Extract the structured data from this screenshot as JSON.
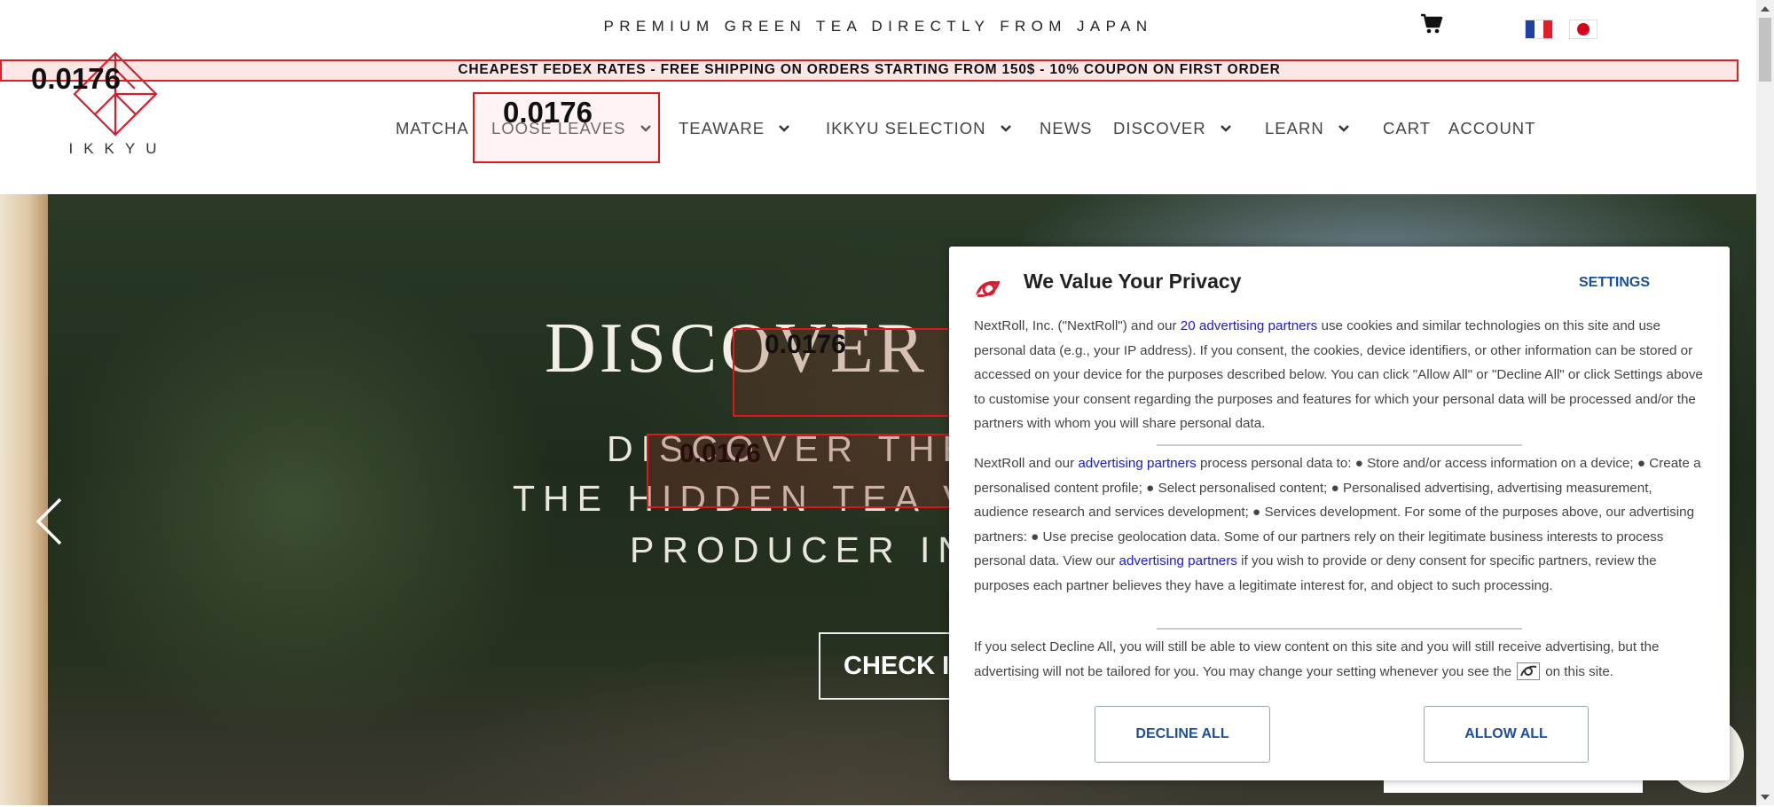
{
  "header": {
    "tagline": "PREMIUM GREEN TEA DIRECTLY FROM JAPAN",
    "icons": {
      "cart": "shopping-cart-icon",
      "french": "flag-france-icon",
      "japanese": "flag-japan-icon"
    }
  },
  "banner": {
    "text": "CHEAPEST FEDEX RATES - FREE SHIPPING ON ORDERS STARTING FROM 150$ - 10% COUPON ON FIRST ORDER"
  },
  "logo": {
    "text": "IKKYU"
  },
  "nav": {
    "items": [
      {
        "label": "MATCHA",
        "dropdown": false
      },
      {
        "label": "LOOSE LEAVES",
        "dropdown": true
      },
      {
        "label": "TEAWARE",
        "dropdown": true
      },
      {
        "label": "IKKYU SELECTION",
        "dropdown": true
      },
      {
        "label": "NEWS",
        "dropdown": false
      },
      {
        "label": "DISCOVER",
        "dropdown": true
      },
      {
        "label": "LEARN",
        "dropdown": true
      },
      {
        "label": "CART",
        "dropdown": false
      },
      {
        "label": "ACCOUNT",
        "dropdown": false
      }
    ]
  },
  "overlay": {
    "labels": [
      "0.0176",
      "0.0176",
      "0.0176",
      "0.0176"
    ],
    "color": "#e01515"
  },
  "hero": {
    "title": "DISCOVER",
    "subtitle_lines": [
      "DISCOVER THE",
      "THE HIDDEN TEA V",
      "PRODUCER IN"
    ],
    "cta": "CHECK IT",
    "prev_icon": "chevron-left-icon"
  },
  "consent": {
    "title": "We Value Your Privacy",
    "settings_label": "SETTINGS",
    "paragraph1": {
      "before_link": "NextRoll, Inc. (\"NextRoll\") and our ",
      "link": "20 advertising partners",
      "after_link": " use cookies and similar technologies on this site and use personal data (e.g., your IP address). If you consent, the cookies, device identifiers, or other information can be stored or accessed on your device for the purposes described below. You can click \"Allow All\" or \"Decline All\" or click Settings above to customise your consent regarding the purposes and features for which your personal data will be processed and/or the partners with whom you will share personal data."
    },
    "paragraph2": {
      "before_link": "NextRoll and our ",
      "link": "advertising partners",
      "middle": " process personal data to: ● Store and/or access information on a device; ● Create a personalised content profile; ● Select personalised content; ● Personalised advertising, advertising measurement, audience research and services development; ● Services development. For some of the purposes above, our advertising partners: ● Use precise geolocation data. Some of our partners rely on their legitimate business interests to process personal data. View our ",
      "link2": "advertising partners",
      "after_link": " if you wish to provide or deny consent for specific partners, review the purposes each partner believes they have a legitimate interest for, and object to such processing."
    },
    "paragraph3": {
      "before_icon": "If you select Decline All, you will still be able to view content on this site and you will still receive advertising, but the advertising will not be tailored for you. You may change your setting whenever you see the",
      "after_icon": "on this site."
    },
    "decline_label": "DECLINE ALL",
    "allow_label": "ALLOW ALL",
    "brand_color": "#d4202c",
    "link_color": "#1a1ad0"
  }
}
